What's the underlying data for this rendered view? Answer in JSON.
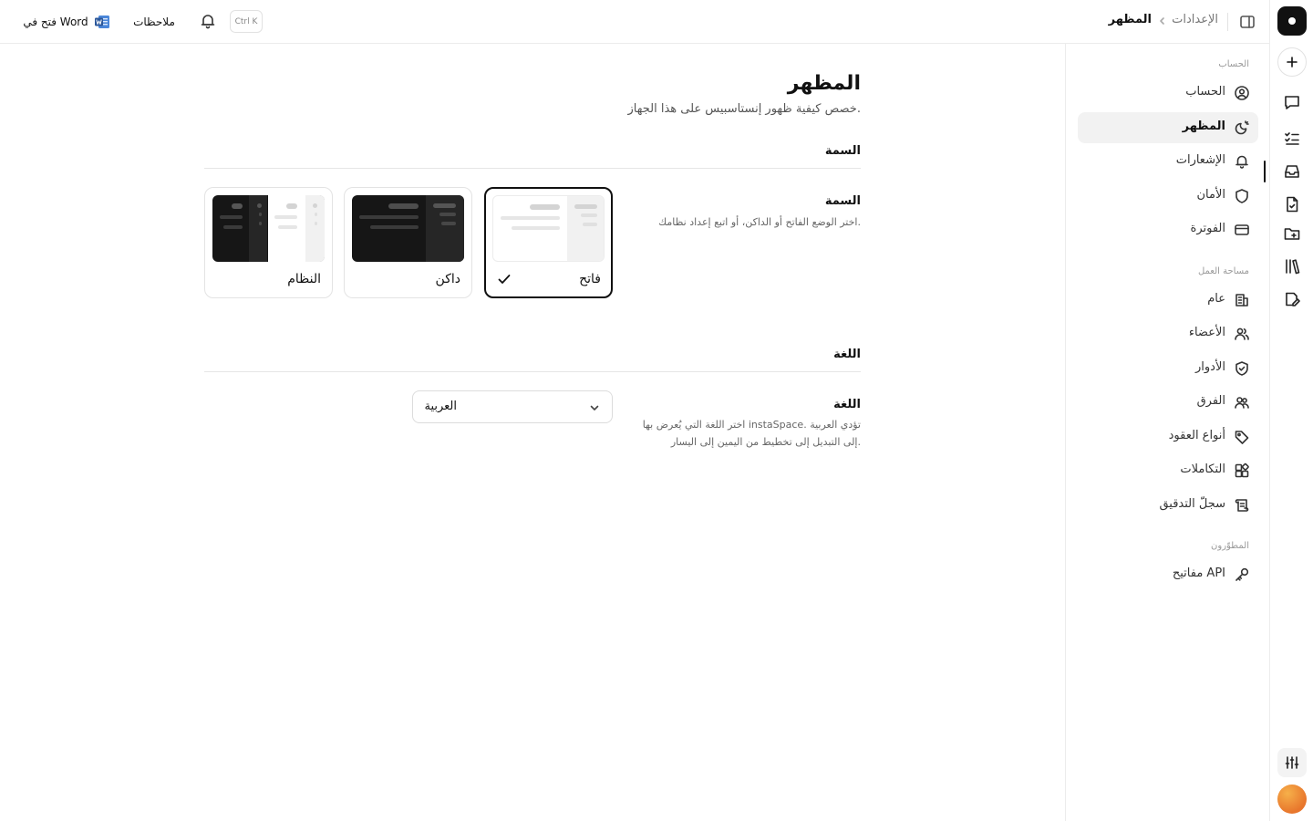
{
  "header": {
    "breadcrumb_parent": "الإعدادات",
    "breadcrumb_current": "المظهر",
    "open_in_word": "فتح في Word",
    "notes": "ملاحظات",
    "command_shortcut": "Ctrl K"
  },
  "rail": {
    "icons": [
      "logo",
      "new-icon",
      "chat-icon",
      "tasks-icon",
      "inbox-icon",
      "document-icon",
      "folder-icon",
      "library-icon",
      "edit-icon",
      "preferences-icon",
      "avatar"
    ]
  },
  "nav": {
    "sections": {
      "account": "الحساب",
      "workspace": "مساحة العمل",
      "developers": "المطوّرون"
    },
    "items": [
      {
        "label": "الحساب",
        "icon": "user-circle-icon"
      },
      {
        "label": "المظهر",
        "icon": "appearance-icon",
        "active": true
      },
      {
        "label": "الإشعارات",
        "icon": "bell-icon"
      },
      {
        "label": "الأمان",
        "icon": "shield-icon"
      },
      {
        "label": "الفوترة",
        "icon": "credit-card-icon"
      },
      {
        "label": "عام",
        "icon": "building-icon"
      },
      {
        "label": "الأعضاء",
        "icon": "users-icon"
      },
      {
        "label": "الأدوار",
        "icon": "shield-check-icon"
      },
      {
        "label": "الفرق",
        "icon": "team-icon"
      },
      {
        "label": "أنواع العقود",
        "icon": "tag-icon"
      },
      {
        "label": "التكاملات",
        "icon": "integrations-icon"
      },
      {
        "label": "سجلّ التدقيق",
        "icon": "scroll-icon"
      },
      {
        "label": "مفاتيح API",
        "icon": "key-icon"
      }
    ]
  },
  "page": {
    "title": "المظهر",
    "subtitle": "خصص كيفية ظهور إنستاسبيس على هذا الجهاز.",
    "theme_section": {
      "title": "السمة",
      "label": "السمة",
      "description": "اختر الوضع الفاتح أو الداكن، أو اتبع إعداد نظامك.",
      "options": [
        {
          "label": "فاتح",
          "selected": true
        },
        {
          "label": "داكن",
          "selected": false
        },
        {
          "label": "النظام",
          "selected": false
        }
      ]
    },
    "language_section": {
      "title": "اللغة",
      "label": "اللغة",
      "description_line1": "اختر اللغة التي يُعرض بها instaSpace. تؤدي العربية",
      "description_line2": "إلى التبديل إلى تخطيط من اليمين إلى اليسار.",
      "selected": "العربية"
    }
  },
  "colors": {
    "accent": "#111111",
    "border": "#e3e3e3",
    "active_bg": "#f2f2f2",
    "dark_preview": "#161616",
    "word_blue": "#2b579a"
  }
}
